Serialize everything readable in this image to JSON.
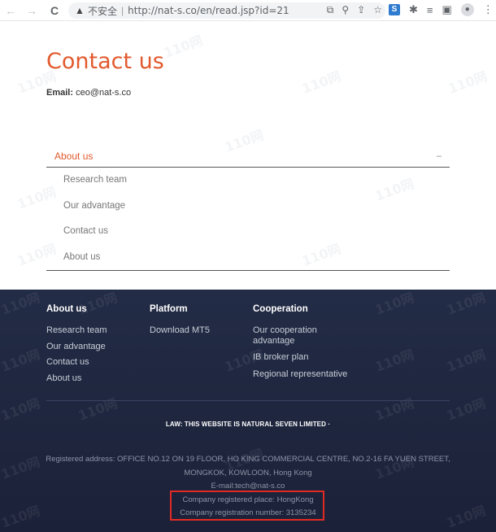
{
  "browser": {
    "back_glyph": "←",
    "forward_glyph": "→",
    "reload_glyph": "C",
    "insecure_label": "不安全",
    "url": "http://nat-s.co/en/read.jsp?id=21"
  },
  "page": {
    "title": "Contact us",
    "email_label": "Email:",
    "email_value": "ceo@nat-s.co"
  },
  "accordion": {
    "header": "About us",
    "toggle": "–",
    "items": [
      "Research team",
      "Our advantage",
      "Contact us",
      "About us"
    ]
  },
  "footer": {
    "about": {
      "heading": "About us",
      "links": [
        "Research team",
        "Our advantage",
        "Contact us",
        "About us"
      ]
    },
    "platform": {
      "heading": "Platform",
      "links": [
        "Download MT5"
      ]
    },
    "cooperation": {
      "heading": "Cooperation",
      "links": [
        "Our cooperation advantage",
        "IB broker plan",
        "Regional representative"
      ]
    },
    "law": "LAW: THIS WEBSITE IS NATURAL SEVEN LIMITED ·",
    "address_line1": "Registered address: OFFICE NO.12 ON 19 FLOOR, HO KING COMMERCIAL CENTRE, NO.2-16 FA YUEN STREET,",
    "address_line2": "MONGKOK, KOWLOON, Hong Kong",
    "email": "E-mail:tech@nat-s.co",
    "registered_place": "Company registered place: HongKong",
    "registration_number": "Company registration number: 3135234"
  },
  "watermark": "110网",
  "colors": {
    "accent": "#e2592d",
    "footer_bg": "#1e2540",
    "highlight_box": "#e12a25"
  }
}
